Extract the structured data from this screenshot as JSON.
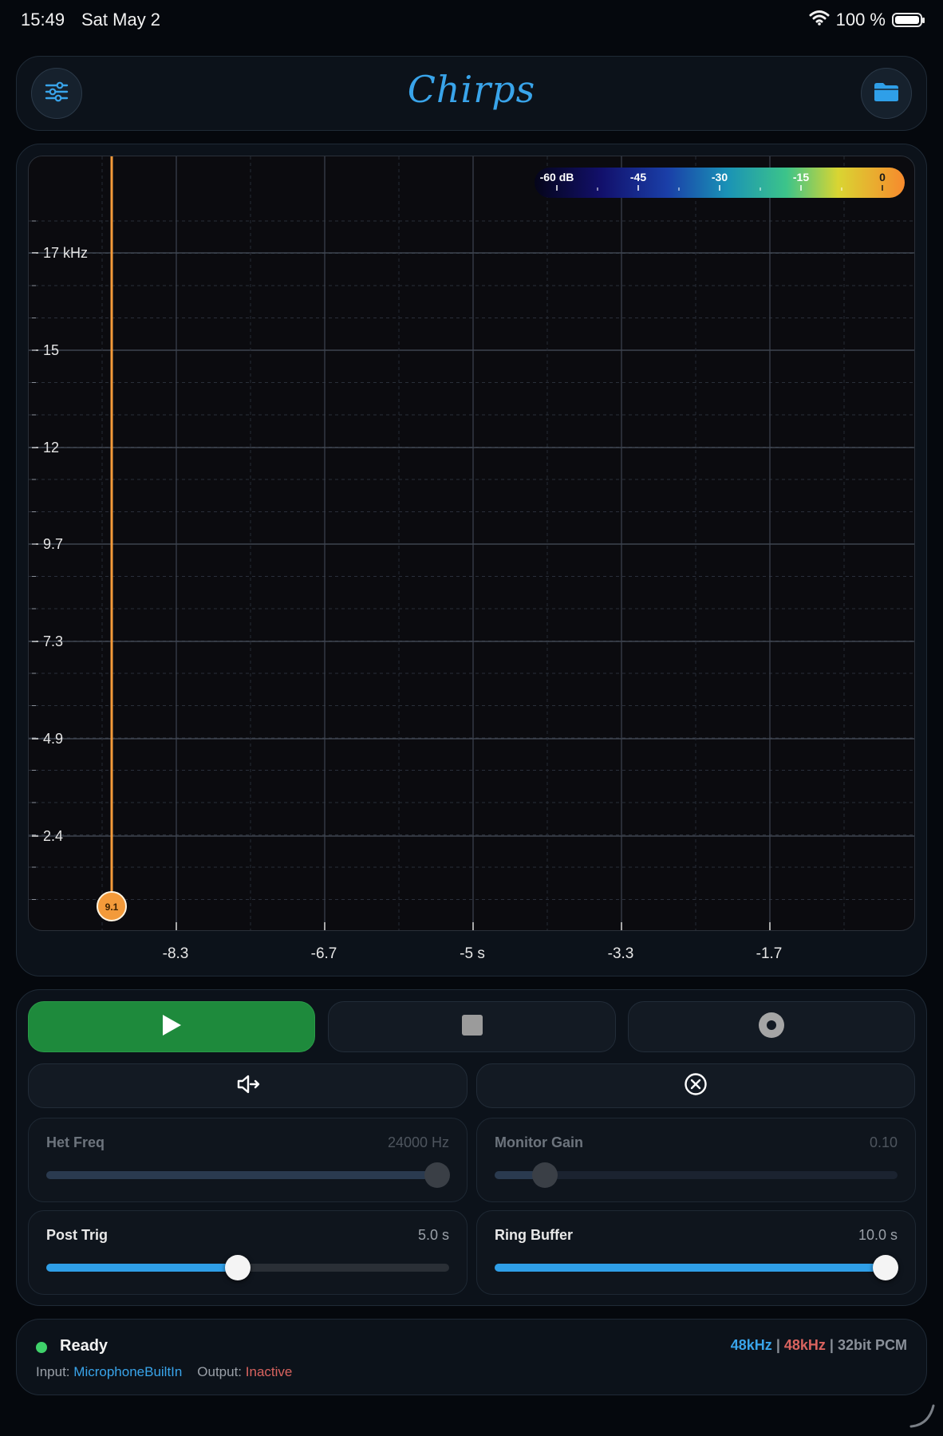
{
  "status_bar": {
    "time": "15:49",
    "date": "Sat May 2",
    "battery_text": "100 %",
    "battery_level": 1.0
  },
  "header": {
    "title": "Chirps",
    "left_icon": "sliders-icon",
    "right_icon": "folder-icon",
    "accent": "#39a4ea"
  },
  "spectrogram": {
    "y_ticks": [
      "17 kHz",
      "15",
      "12",
      "9.7",
      "7.3",
      "4.9",
      "2.4"
    ],
    "x_ticks": [
      "-8.3",
      "-6.7",
      "-5 s",
      "-3.3",
      "-1.7"
    ],
    "colorbar_labels": [
      "-60 dB",
      "-45",
      "-30",
      "-15",
      "0"
    ],
    "cursor_label": "9.1",
    "cursor_color": "#f39a3a"
  },
  "controls": {
    "play_icon": "play-icon",
    "stop_icon": "stop-icon",
    "record_icon": "record-icon",
    "monitor_icon": "speaker-arrow-icon",
    "clear_icon": "cancel-circle-icon",
    "play_color": "#1e8a3c"
  },
  "sliders": [
    {
      "label": "Het Freq",
      "value": "24000 Hz",
      "fraction": 0.97,
      "enabled": false
    },
    {
      "label": "Monitor Gain",
      "value": "0.10",
      "fraction": 0.125,
      "enabled": false
    },
    {
      "label": "Post Trig",
      "value": "5.0 s",
      "fraction": 0.475,
      "enabled": true
    },
    {
      "label": "Ring Buffer",
      "value": "10.0 s",
      "fraction": 0.97,
      "enabled": true
    }
  ],
  "status": {
    "state": "Ready",
    "input_label": "Input:",
    "input_value": "MicrophoneBuiltIn",
    "output_label": "Output:",
    "output_value": "Inactive",
    "rate_in": "48kHz",
    "separator": "|",
    "rate_out": "48kHz",
    "format": "32bit PCM",
    "ready_color": "#3fd16a"
  }
}
